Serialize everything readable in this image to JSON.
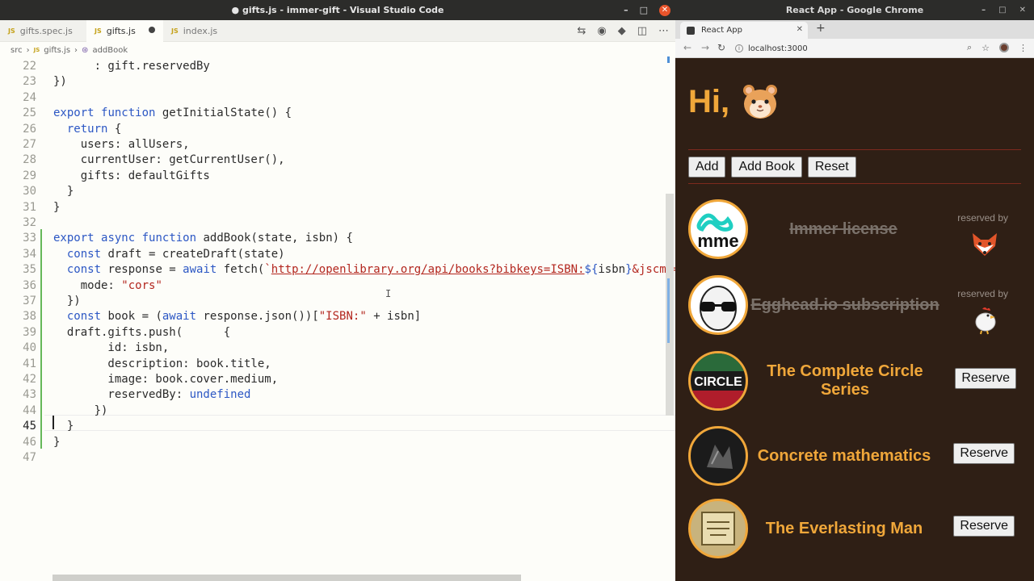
{
  "vscode": {
    "window_title": "● gifts.js - immer-gift - Visual Studio Code",
    "tabs": [
      {
        "label": "gifts.spec.js",
        "lang": "JS"
      },
      {
        "label": "gifts.js",
        "lang": "JS",
        "modified": true
      },
      {
        "label": "index.js",
        "lang": "JS"
      }
    ],
    "breadcrumb": [
      "src",
      "gifts.js",
      "addBook"
    ],
    "lines": [
      {
        "n": "22",
        "html": "      : gift.reservedBy"
      },
      {
        "n": "23",
        "html": "})"
      },
      {
        "n": "24",
        "html": ""
      },
      {
        "n": "25",
        "html": "<span class=\"k\">export</span> <span class=\"k\">function</span> getInitialState() {"
      },
      {
        "n": "26",
        "html": "  <span class=\"k\">return</span> {"
      },
      {
        "n": "27",
        "html": "    users: allUsers,"
      },
      {
        "n": "28",
        "html": "    currentUser: getCurrentUser(),"
      },
      {
        "n": "29",
        "html": "    gifts: defaultGifts"
      },
      {
        "n": "30",
        "html": "  }"
      },
      {
        "n": "31",
        "html": "}"
      },
      {
        "n": "32",
        "html": ""
      },
      {
        "n": "33",
        "html": "<span class=\"k\">export</span> <span class=\"k\">async</span> <span class=\"k\">function</span> addBook(state, isbn) {"
      },
      {
        "n": "34",
        "html": "  <span class=\"k\">const</span> draft = createDraft(state)"
      },
      {
        "n": "35",
        "html": "  <span class=\"k\">const</span> response = <span class=\"k\">await</span> fetch(<span class=\"s\">`</span><span class=\"u\">http://openlibrary.org/api/books?bibkeys=ISBN:</span><span class=\"t\">${</span>isbn<span class=\"t\">}</span><span class=\"s\">&amp;jscmd=data&amp;format=json`</span>, {"
      },
      {
        "n": "36",
        "html": "    mode: <span class=\"s\">\"cors\"</span>"
      },
      {
        "n": "37",
        "html": "  })"
      },
      {
        "n": "38",
        "html": "  <span class=\"k\">const</span> book = (<span class=\"k\">await</span> response.json())[<span class=\"s\">\"ISBN:\"</span> + isbn]"
      },
      {
        "n": "39",
        "html": "  draft.gifts.push(      {"
      },
      {
        "n": "40",
        "html": "        id: isbn,"
      },
      {
        "n": "41",
        "html": "        description: book.title,"
      },
      {
        "n": "42",
        "html": "        image: book.cover.medium,"
      },
      {
        "n": "43",
        "html": "        reservedBy: <span class=\"k\">undefined</span>"
      },
      {
        "n": "44",
        "html": "      })"
      },
      {
        "n": "45",
        "html": "  }"
      },
      {
        "n": "46",
        "html": "}"
      },
      {
        "n": "47",
        "html": ""
      }
    ]
  },
  "chrome": {
    "window_title": "React App - Google Chrome",
    "tab_label": "React App",
    "url": "localhost:3000",
    "app": {
      "greeting": "Hi,",
      "buttons": [
        "Add",
        "Add Book",
        "Reset"
      ],
      "reserved_by_label": "reserved by",
      "reserve_label": "Reserve",
      "gifts": [
        {
          "description": "Immer license",
          "reserved": true,
          "reserver": "fox"
        },
        {
          "description": "Egghead.io subscription",
          "reserved": true,
          "reserver": "chicken"
        },
        {
          "description": "The Complete Circle Series",
          "reserved": false
        },
        {
          "description": "Concrete mathematics",
          "reserved": false
        },
        {
          "description": "The Everlasting Man",
          "reserved": false
        }
      ]
    }
  },
  "colors": {
    "accent": "#f0a73a",
    "app_bg": "#2f1f15",
    "keyword": "#2c57c4",
    "string": "#b3261e"
  }
}
